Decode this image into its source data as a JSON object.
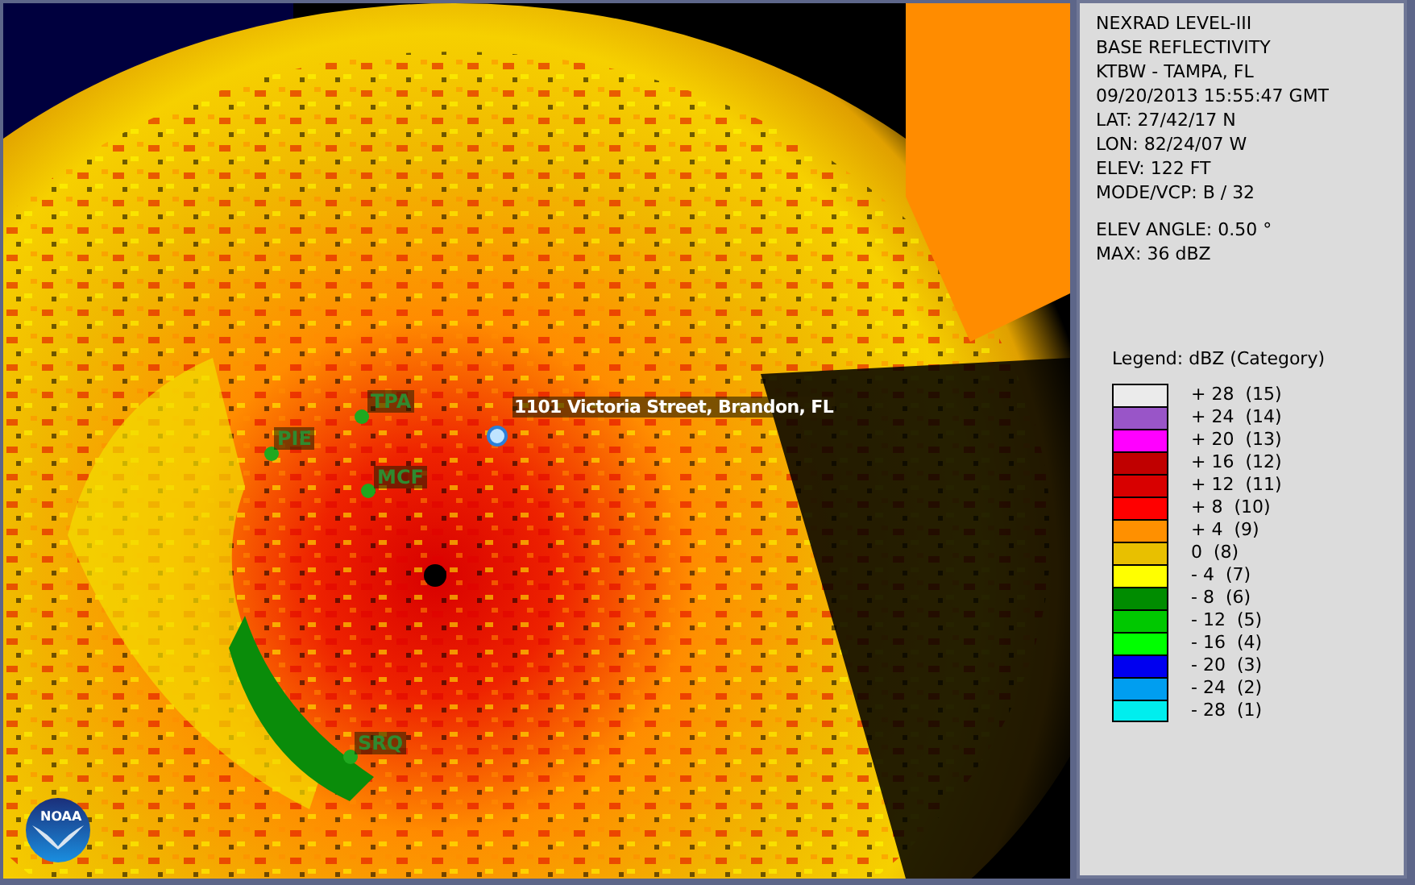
{
  "map": {
    "stations": [
      {
        "text": "TPA"
      },
      {
        "text": "PIE"
      },
      {
        "text": "MCF"
      },
      {
        "text": "SRQ"
      }
    ],
    "location": {
      "text": "1101 Victoria Street, Brandon, FL"
    },
    "logo": {
      "text": "NOAA"
    }
  },
  "info": {
    "header_lines": [
      "NEXRAD LEVEL-III",
      "BASE REFLECTIVITY",
      "KTBW - TAMPA, FL",
      "09/20/2013 15:55:47 GMT",
      "LAT: 27/42/17 N",
      "LON: 82/24/07 W",
      "ELEV: 122 FT",
      "MODE/VCP: B / 32"
    ],
    "scan_lines": [
      "ELEV ANGLE: 0.50 °",
      "MAX: 36 dBZ"
    ]
  },
  "legend": {
    "title": "Legend: dBZ (Category)",
    "items": [
      {
        "label": "+ 28  (15)",
        "color": "#ebebeb"
      },
      {
        "label": "+ 24  (14)",
        "color": "#9955c8"
      },
      {
        "label": "+ 20  (13)",
        "color": "#ff00ff"
      },
      {
        "label": "+ 16  (12)",
        "color": "#c00000"
      },
      {
        "label": "+ 12  (11)",
        "color": "#d80000"
      },
      {
        "label": "+ 8  (10)",
        "color": "#ff0000"
      },
      {
        "label": "+ 4  (9)",
        "color": "#ff9000"
      },
      {
        "label": "0  (8)",
        "color": "#e8c000"
      },
      {
        "label": "- 4  (7)",
        "color": "#ffff00"
      },
      {
        "label": "- 8  (6)",
        "color": "#008c00"
      },
      {
        "label": "- 12  (5)",
        "color": "#00c800"
      },
      {
        "label": "- 16  (4)",
        "color": "#00ff00"
      },
      {
        "label": "- 20  (3)",
        "color": "#0000f0"
      },
      {
        "label": "- 24  (2)",
        "color": "#009ef0"
      },
      {
        "label": "- 28  (1)",
        "color": "#00eeee"
      }
    ]
  }
}
